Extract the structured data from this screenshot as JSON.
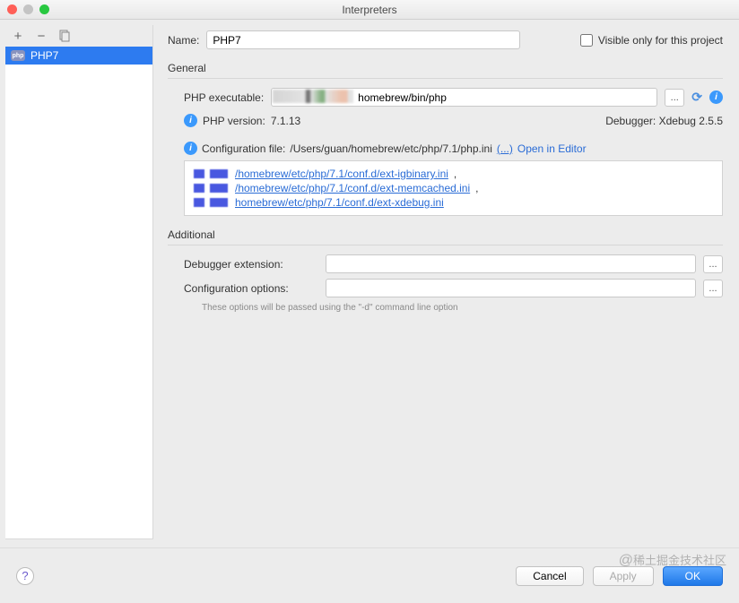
{
  "window": {
    "title": "Interpreters"
  },
  "sidebar": {
    "items": [
      {
        "label": "PHP7"
      }
    ]
  },
  "form": {
    "name_label": "Name:",
    "name_value": "PHP7",
    "visible_label": "Visible only for this project"
  },
  "general": {
    "title": "General",
    "exec_label": "PHP executable:",
    "exec_value": "homebrew/bin/php",
    "browse": "...",
    "version_label": "PHP version:",
    "version_value": "7.1.13",
    "debugger_label": "Debugger:",
    "debugger_value": "Xdebug 2.5.5",
    "conf_label": "Configuration file:",
    "conf_value": "/Users/guan/homebrew/etc/php/7.1/php.ini",
    "conf_more": "(...)",
    "open_editor": "Open in Editor",
    "conf_files": [
      "/homebrew/etc/php/7.1/conf.d/ext-igbinary.ini",
      "/homebrew/etc/php/7.1/conf.d/ext-memcached.ini",
      "homebrew/etc/php/7.1/conf.d/ext-xdebug.ini"
    ]
  },
  "additional": {
    "title": "Additional",
    "debugger_ext_label": "Debugger extension:",
    "conf_opts_label": "Configuration options:",
    "hint": "These options will be passed using the \"-d\" command line option"
  },
  "buttons": {
    "cancel": "Cancel",
    "apply": "Apply",
    "ok": "OK"
  },
  "watermark": "稀土掘金技术社区"
}
